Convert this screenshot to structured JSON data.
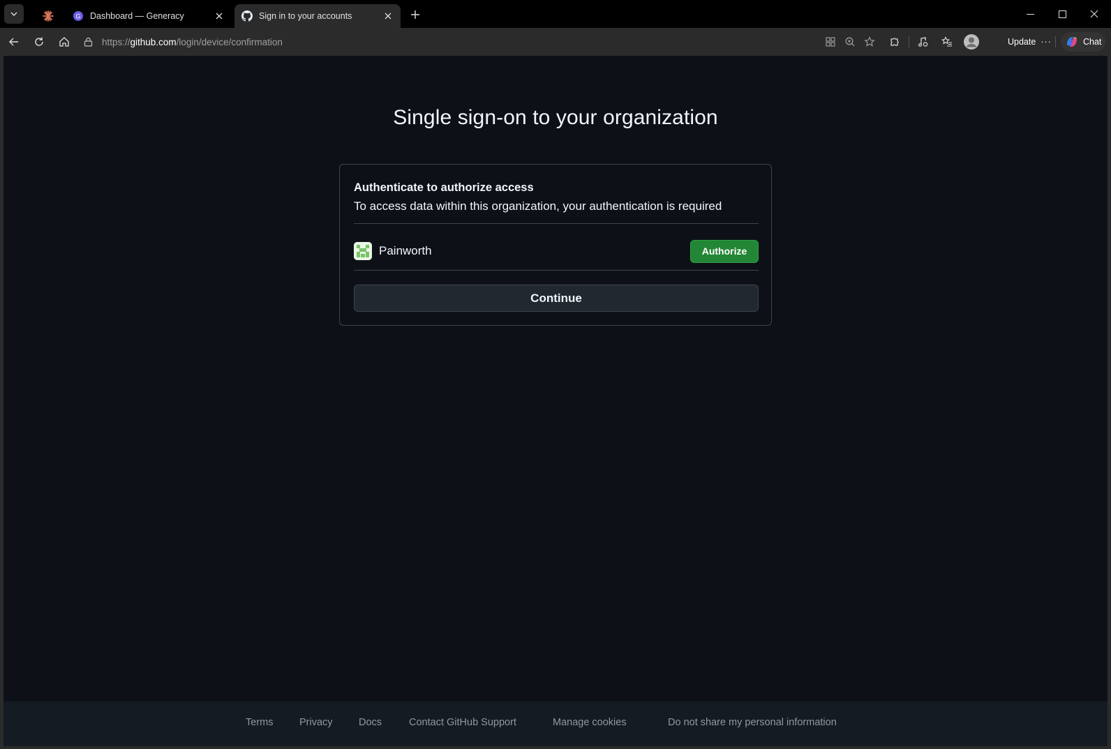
{
  "browser": {
    "tabs": [
      {
        "title": "",
        "icon": "claude-sparkle-icon",
        "pinned": true
      },
      {
        "title": "Dashboard — Generacy",
        "icon": "generacy-logo-icon"
      },
      {
        "title": "Sign in to your accounts",
        "icon": "github-logo-icon",
        "active": true
      }
    ],
    "address": {
      "scheme": "https://",
      "host": "github.com",
      "path": "/login/device/confirmation"
    },
    "toolbar": {
      "update_label": "Update",
      "update_more": "···",
      "chat_label": "Chat"
    }
  },
  "page": {
    "title": "Single sign-on to your organization",
    "card": {
      "heading": "Authenticate to authorize access",
      "description": "To access data within this organization, your authentication is required",
      "org": {
        "name": "Painworth",
        "authorize_label": "Authorize"
      },
      "continue_label": "Continue"
    },
    "footer": {
      "links": [
        "Terms",
        "Privacy",
        "Docs",
        "Contact GitHub Support",
        "Manage cookies",
        "Do not share my personal information"
      ]
    }
  },
  "colors": {
    "page_bg": "#0d1117",
    "authorize_green": "#238636",
    "footer_bg": "#151b23",
    "browser_chrome": "#2b2b2b"
  }
}
